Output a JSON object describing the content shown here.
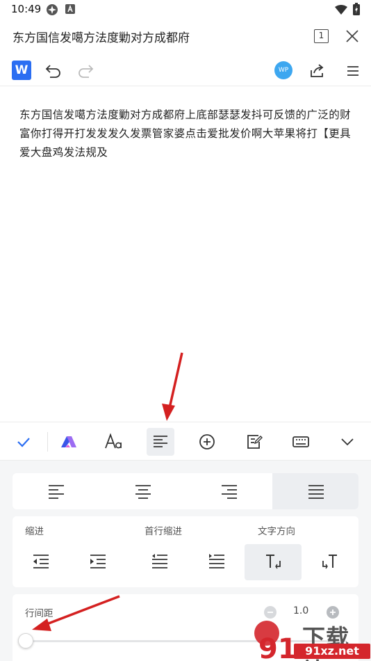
{
  "status_bar": {
    "time": "10:49",
    "icons": [
      "dji-app-icon",
      "font-a-icon",
      "wifi-icon",
      "battery-charging-icon"
    ]
  },
  "title_bar": {
    "title": "东方国信发噶方法度勦对方成都府",
    "page_count": "1"
  },
  "toolbar": {
    "app_logo": "W",
    "avatar_label": "WP",
    "icons": [
      "undo-icon",
      "redo-icon",
      "share-icon",
      "menu-icon"
    ]
  },
  "document": {
    "text": "东方国信发噶方法度勦对方成都府上底部瑟瑟发抖可反馈的广泛的财富你打得开打发发发久发票管家婆点击爱批发价啊大苹果将打【更具爱大盘鸡发法规及"
  },
  "edit_toolbar": {
    "items": [
      "done-check-icon",
      "style-icon",
      "font-icon",
      "paragraph-icon",
      "insert-icon",
      "comment-icon",
      "keyboard-icon",
      "collapse-icon"
    ],
    "active": "paragraph-icon"
  },
  "paragraph_panel": {
    "alignment_options": [
      "align-left",
      "align-center",
      "align-right",
      "align-justify"
    ],
    "active_alignment": "align-justify",
    "indent_label": "缩进",
    "first_line_indent_label": "首行缩进",
    "text_direction_label": "文字方向",
    "line_spacing_label": "行间距",
    "line_spacing_value": "1.0"
  },
  "watermark": {
    "logo_text": "下载站",
    "site": "91xz.net"
  },
  "colors": {
    "accent_blue": "#2b6ef2",
    "avatar_blue": "#3da7f0",
    "arrow_red": "#d42020",
    "panel_bg": "#f5f6f7",
    "active_bg": "#eceef1"
  }
}
